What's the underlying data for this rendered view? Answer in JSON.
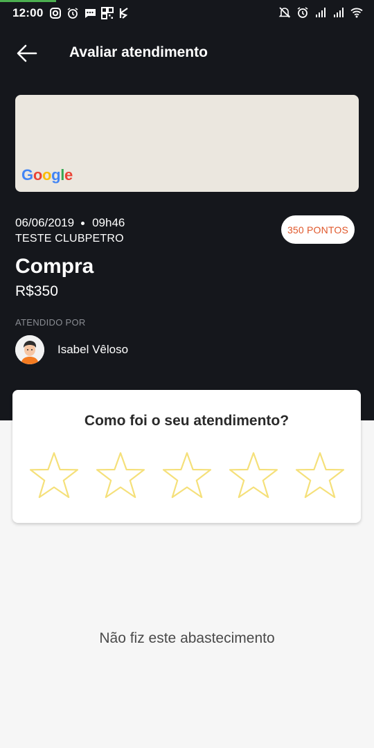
{
  "status_bar": {
    "time": "12:00",
    "left_icons": [
      "instagram-icon",
      "alarm-icon",
      "message-icon",
      "qr-icon",
      "app-icon"
    ],
    "right_icons": [
      "mute-icon",
      "alarm-icon",
      "signal-icon",
      "signal-icon",
      "wifi-icon"
    ]
  },
  "header": {
    "title": "Avaliar atendimento"
  },
  "map": {
    "logo_letters": [
      "G",
      "o",
      "o",
      "g",
      "l",
      "e"
    ]
  },
  "transaction": {
    "date": "06/06/2019",
    "time": "09h46",
    "store": "TESTE CLUBPETRO",
    "points": "350 PONTOS",
    "type": "Compra",
    "amount": "R$350",
    "served_by_label": "ATENDIDO POR",
    "attendant_name": "Isabel Vêloso"
  },
  "rating": {
    "question": "Como foi o seu atendimento?",
    "max_stars": 5,
    "selected": 0,
    "star_color": "#f5e07a"
  },
  "footer": {
    "not_done_label": "Não fiz este abastecimento"
  },
  "colors": {
    "dark_bg": "#15171c",
    "accent": "#e0572a",
    "page_bg": "#f6f6f6"
  }
}
